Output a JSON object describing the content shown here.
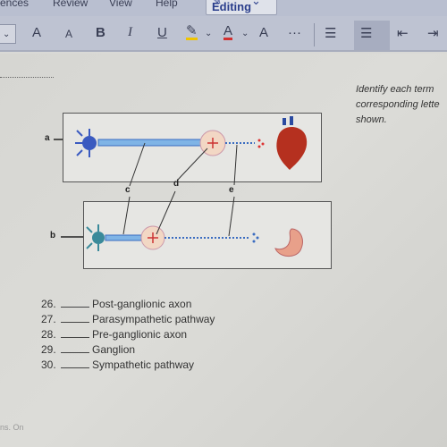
{
  "menu": {
    "items": [
      "rences",
      "Review",
      "View",
      "Help"
    ],
    "editing_label": "Editing"
  },
  "toolbar": {
    "buttons": [
      "A˄",
      "A˅",
      "B",
      "I",
      "U",
      "highlight",
      "font-color",
      "clear-format",
      "…",
      "bullets",
      "numbering",
      "decrease-indent",
      "increase-indent"
    ],
    "glyphs": {
      "grow": "A",
      "shrink": "A",
      "bold": "B",
      "italic": "I",
      "underline": "U",
      "more": "···"
    }
  },
  "colors": {
    "highlight": "#f0c400",
    "font_color": "#d23030",
    "editing_text": "#2a3e8c"
  },
  "instructions": [
    "Identify each term",
    "corresponding lette",
    "shown."
  ],
  "diagram": {
    "labels": {
      "a": "a",
      "b": "b",
      "c": "c",
      "d": "d",
      "e": "e"
    }
  },
  "questions": [
    {
      "num": "26.",
      "text": "Post-ganglionic axon"
    },
    {
      "num": "27.",
      "text": "Parasympathetic pathway"
    },
    {
      "num": "28.",
      "text": "Pre-ganglionic axon"
    },
    {
      "num": "29.",
      "text": "Ganglion"
    },
    {
      "num": "30.",
      "text": "Sympathetic pathway"
    }
  ],
  "footer": "ns. On"
}
